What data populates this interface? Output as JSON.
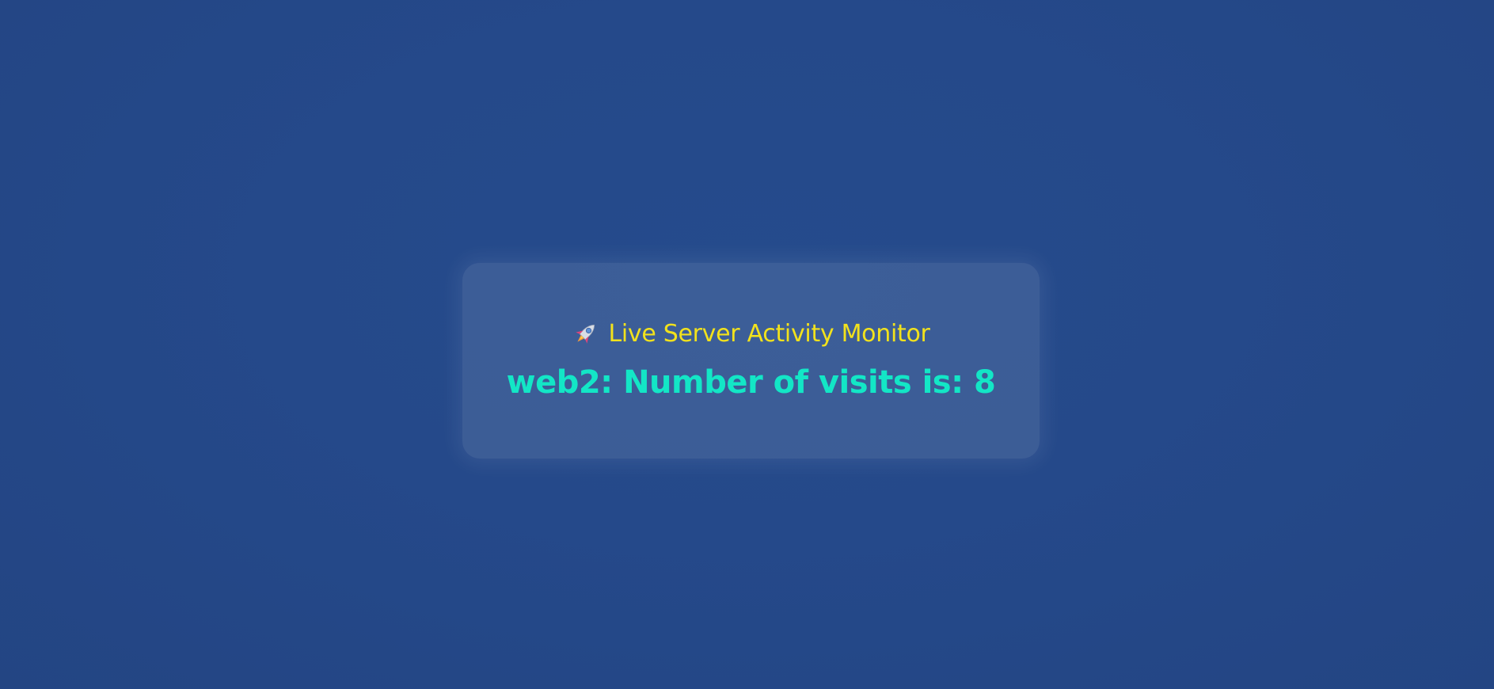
{
  "monitor": {
    "title": "Live Server Activity Monitor",
    "title_icon": "rocket-icon",
    "server_name": "web2",
    "visits_label": "Number of visits is:",
    "visits_count": "8"
  },
  "colors": {
    "background": "#254a8a",
    "title": "#f2e21c",
    "visits": "#13e6c6"
  }
}
